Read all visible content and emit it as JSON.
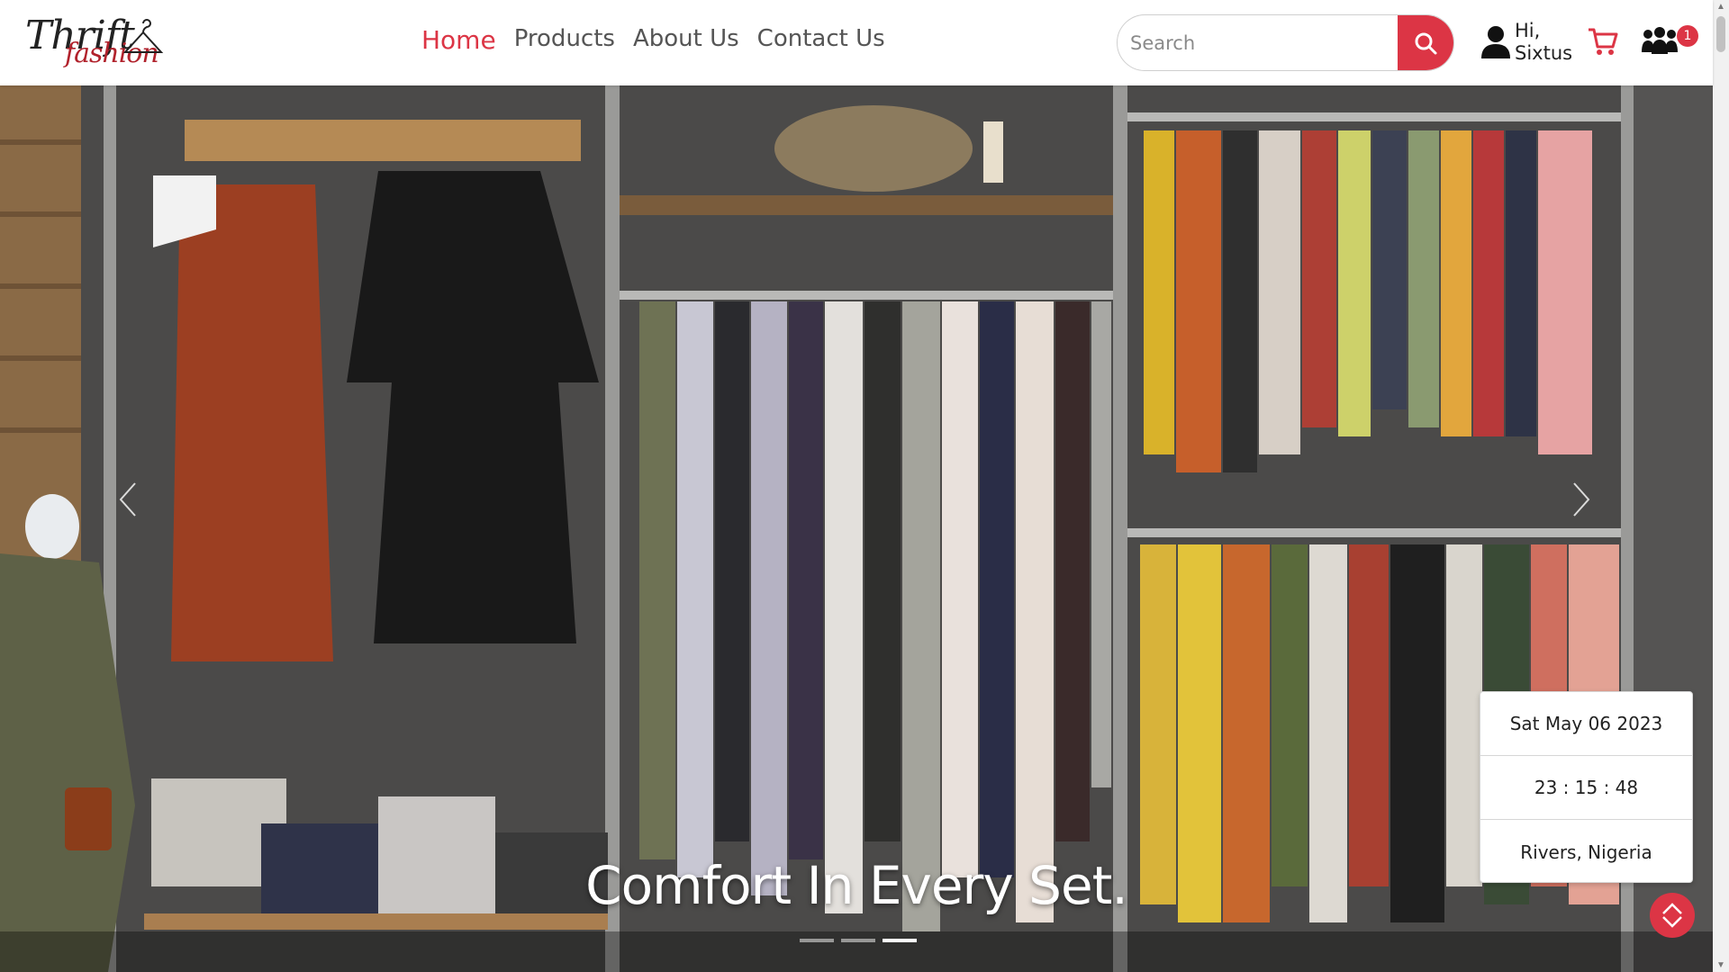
{
  "brand": {
    "logo_line1": "Thrift",
    "logo_line2": "fashion"
  },
  "nav": {
    "links": [
      {
        "label": "Home",
        "active": true
      },
      {
        "label": "Products"
      },
      {
        "label": "About Us"
      },
      {
        "label": "Contact Us"
      }
    ]
  },
  "search": {
    "placeholder": "Search",
    "value": ""
  },
  "user": {
    "greeting_line1": "Hi,",
    "greeting_line2": "Sixtus"
  },
  "cart": {
    "icon": "cart-icon"
  },
  "community": {
    "icon": "community-icon",
    "badge_count": "1"
  },
  "hero": {
    "caption": "Comfort In Every Set.",
    "slides_total": 3,
    "active_slide": 3
  },
  "date_widget": {
    "date": "Sat May 06 2023",
    "time": "23 : 15 : 48",
    "location": "Rivers, Nigeria"
  },
  "colors": {
    "accent": "#dc3545",
    "nav_text": "#555555"
  }
}
